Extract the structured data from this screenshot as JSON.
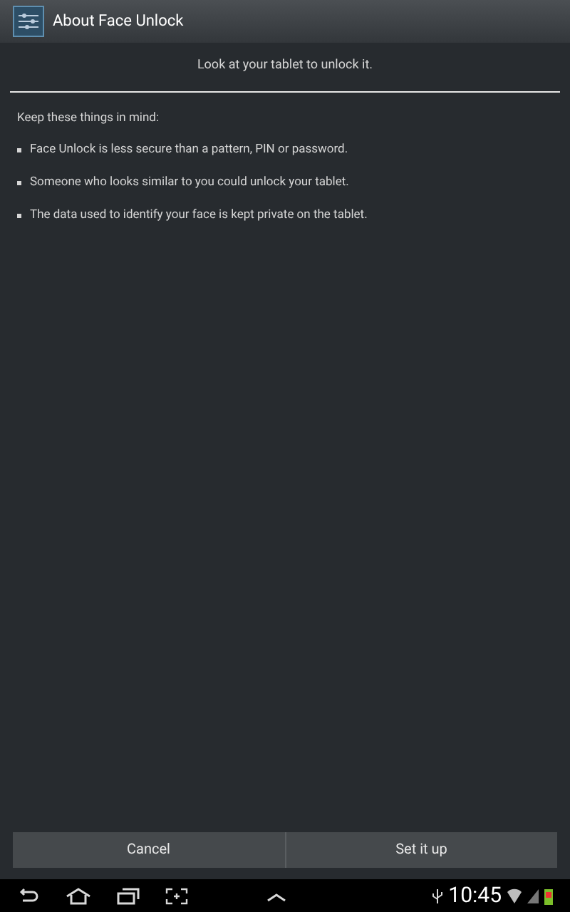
{
  "action_bar": {
    "title": "About Face Unlock"
  },
  "intro": "Look at your tablet to unlock it.",
  "notes": {
    "heading": "Keep these things in mind:",
    "items": [
      "Face Unlock is less secure than a pattern, PIN or password.",
      "Someone who looks similar to you could unlock your tablet.",
      "The data used to identify your face is kept private on the tablet."
    ]
  },
  "buttons": [
    "Cancel",
    "Set it up"
  ],
  "status_bar": {
    "time": "10:45"
  }
}
